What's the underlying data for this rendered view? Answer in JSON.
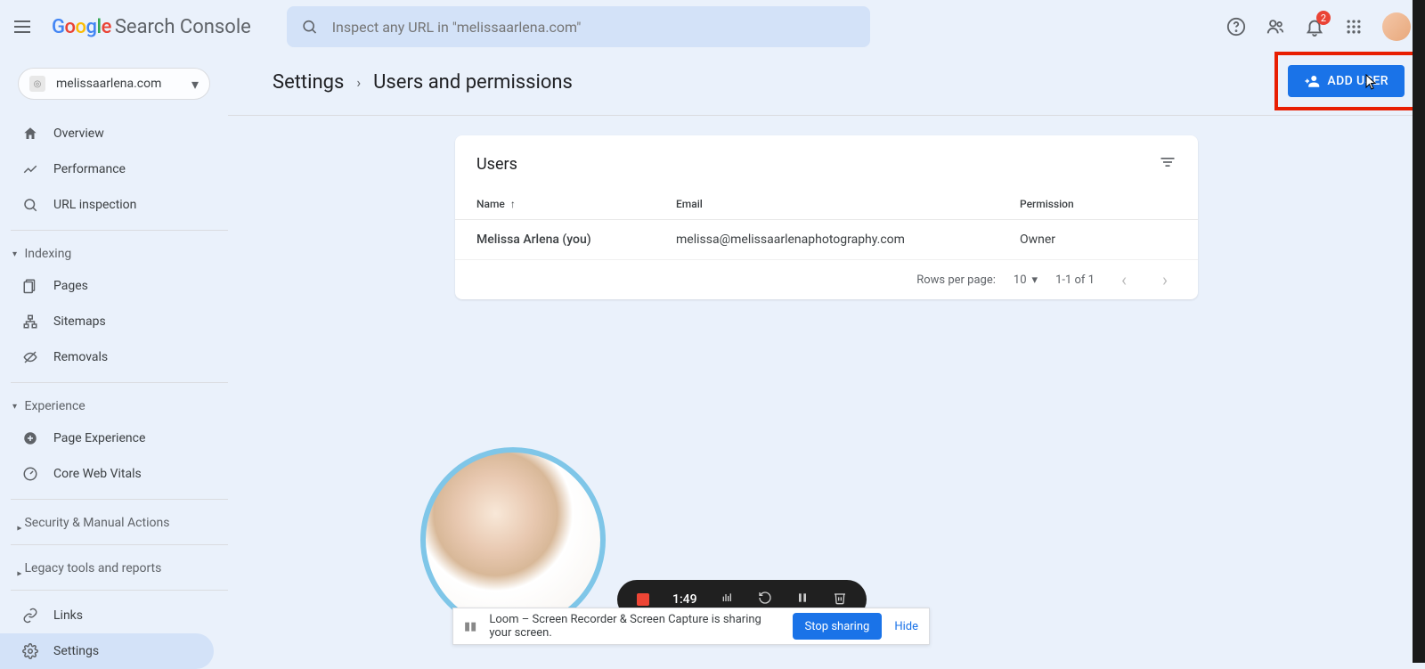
{
  "header": {
    "logo_product": "Search Console",
    "search_placeholder": "Inspect any URL in \"melissaarlena.com\"",
    "notification_count": "2"
  },
  "sidebar": {
    "property": "melissaarlena.com",
    "items": {
      "overview": "Overview",
      "performance": "Performance",
      "url_inspection": "URL inspection"
    },
    "sections": {
      "indexing": "Indexing",
      "experience": "Experience",
      "security": "Security & Manual Actions",
      "legacy": "Legacy tools and reports"
    },
    "indexing_items": {
      "pages": "Pages",
      "sitemaps": "Sitemaps",
      "removals": "Removals"
    },
    "experience_items": {
      "page_exp": "Page Experience",
      "cwv": "Core Web Vitals"
    },
    "links": "Links",
    "settings": "Settings"
  },
  "breadcrumb": {
    "settings": "Settings",
    "current": "Users and permissions"
  },
  "add_user_button": "ADD USER",
  "users_card": {
    "title": "Users",
    "columns": {
      "name": "Name",
      "email": "Email",
      "permission": "Permission"
    },
    "rows": [
      {
        "name": "Melissa Arlena (you)",
        "email": "melissa@melissaarlenaphotography.com",
        "permission": "Owner"
      }
    ],
    "footer": {
      "rows_label": "Rows per page:",
      "rows_value": "10",
      "range": "1-1 of 1"
    }
  },
  "recorder": {
    "time": "1:49"
  },
  "share_bar": {
    "text": "Loom – Screen Recorder & Screen Capture is sharing your screen.",
    "stop": "Stop sharing",
    "hide": "Hide"
  }
}
